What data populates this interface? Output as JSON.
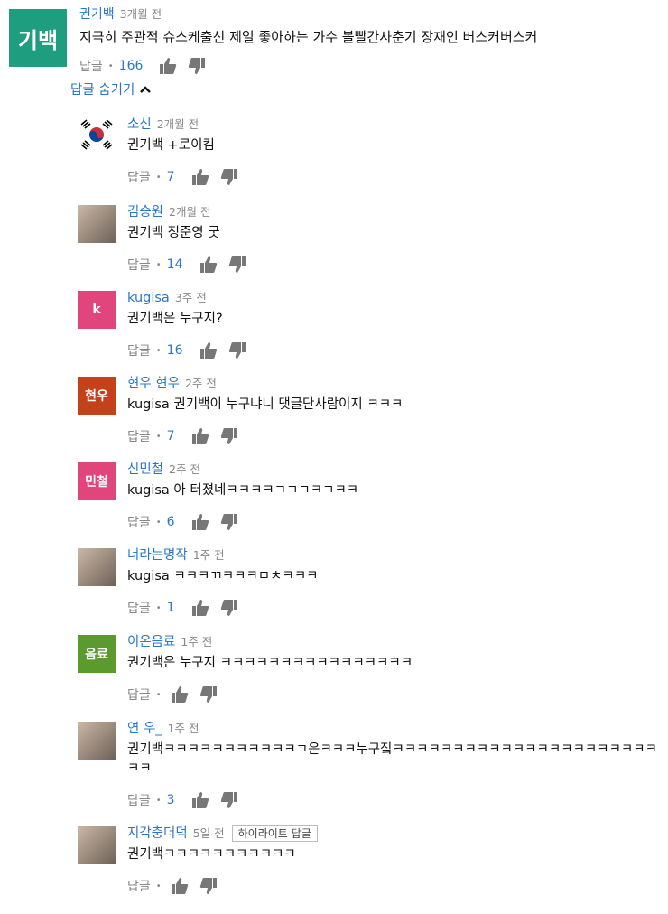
{
  "top_comment": {
    "avatar_text": "기백",
    "author": "권기백",
    "time": "3개월 전",
    "text": "지극히 주관적 슈스케출신 제일 좋아하는 가수 볼빨간사춘기 장재인 버스커버스커",
    "reply_label": "답글",
    "likes": "166"
  },
  "hide_replies_label": "답글 숨기기",
  "colors": {
    "link": "#2a77c9",
    "top_avatar": "#1e9e7e"
  },
  "replies": [
    {
      "author": "소신",
      "time": "2개월 전",
      "text": "권기백 +로이킴",
      "reply_label": "답글",
      "likes": "7",
      "avatar": {
        "type": "flag-icon"
      }
    },
    {
      "author": "김승원",
      "time": "2개월 전",
      "text": "권기백 정준영 굿",
      "reply_label": "답글",
      "likes": "14",
      "avatar": {
        "type": "photo"
      }
    },
    {
      "author": "kugisa",
      "time": "3주 전",
      "text": "권기백은 누구지?",
      "reply_label": "답글",
      "likes": "16",
      "avatar": {
        "type": "letter",
        "text": "k",
        "color": "#e0457b"
      }
    },
    {
      "author": "현우 현우",
      "time": "2주 전",
      "text": "kugisa 권기백이 누구냐니 댓글단사람이지 ㅋㅋㅋ",
      "reply_label": "답글",
      "likes": "7",
      "avatar": {
        "type": "letter",
        "text": "현우",
        "color": "#c4421a"
      }
    },
    {
      "author": "신민철",
      "time": "2주 전",
      "text": "kugisa 아 터졌네ㅋㅋㅋㅋㄱㄱㄱㅋㄱㅋㅋ",
      "reply_label": "답글",
      "likes": "6",
      "avatar": {
        "type": "letter",
        "text": "민철",
        "color": "#e0457b"
      }
    },
    {
      "author": "너라는명작",
      "time": "1주 전",
      "text": "kugisa ㅋㅋㅋㄲㅋㅋㅋㅁㅊㅋㅋㅋ",
      "reply_label": "답글",
      "likes": "1",
      "avatar": {
        "type": "photo"
      }
    },
    {
      "author": "이온음료",
      "time": "1주 전",
      "text": "권기백은 누구지 ㅋㅋㅋㅋㅋㅋㅋㅋㅋㅋㅋㅋㅋㅋㅋㅋ",
      "reply_label": "답글",
      "likes": "",
      "avatar": {
        "type": "letter",
        "text": "음료",
        "color": "#5a9a2e"
      }
    },
    {
      "author": "연 우_",
      "time": "1주 전",
      "text": "권기백ㅋㅋㅋㅋㅋㅋㅋㅋㅋㅋㅋㄱ은ㅋㅋㅋ누구짘ㅋㅋㅋㅋㅋㅋㅋㅋㅋㅋㅋㅋㅋㅋㅋㅋㅋㅋㅋㅋㅋㅋㅋㅋ",
      "reply_label": "답글",
      "likes": "3",
      "avatar": {
        "type": "photo"
      }
    },
    {
      "author": "지각충더덕",
      "time": "5일 전",
      "badge": "하이라이트 답글",
      "text": "권기백ㅋㅋㅋㅋㅋㅋㅋㅋㅋㅋㅋ",
      "reply_label": "답글",
      "likes": "",
      "avatar": {
        "type": "photo"
      }
    }
  ]
}
